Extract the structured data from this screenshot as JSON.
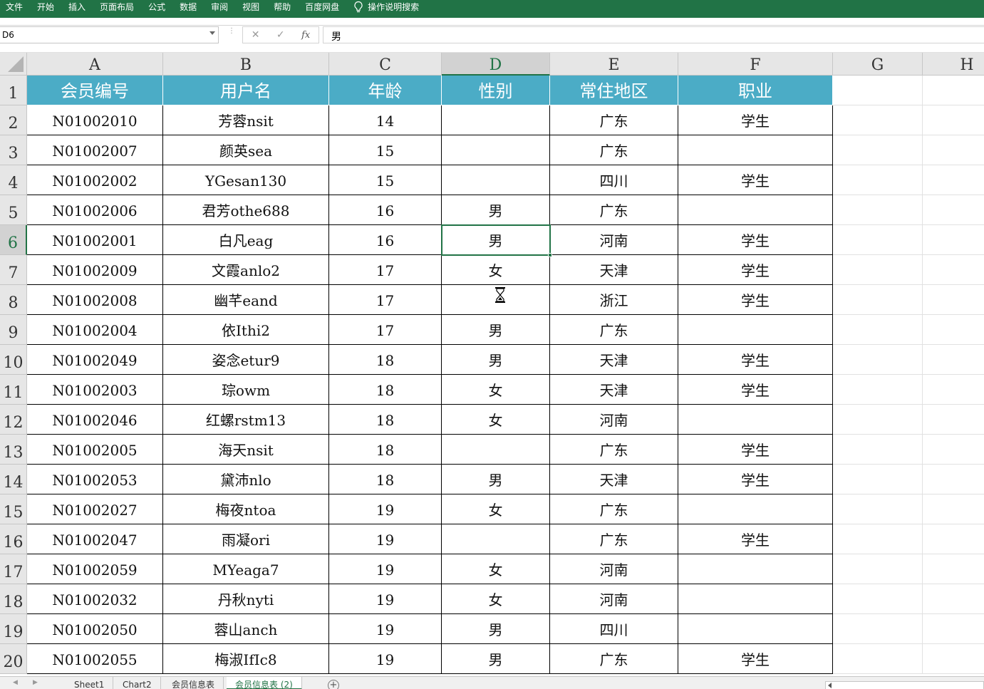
{
  "ribbon": {
    "tabs": [
      "文件",
      "开始",
      "插入",
      "页面布局",
      "公式",
      "数据",
      "审阅",
      "视图",
      "帮助",
      "百度网盘"
    ],
    "search_label": "操作说明搜索"
  },
  "formula_bar": {
    "name_box": "D6",
    "formula": "男"
  },
  "columns": [
    "A",
    "B",
    "C",
    "D",
    "E",
    "F",
    "G",
    "H"
  ],
  "selected_column": "D",
  "selected_row": 6,
  "rows": [
    "1",
    "2",
    "3",
    "4",
    "5",
    "6",
    "7",
    "8",
    "9",
    "10",
    "11",
    "12",
    "13",
    "14",
    "15",
    "16",
    "17",
    "18",
    "19",
    "20"
  ],
  "table": {
    "headers": [
      "会员编号",
      "用户名",
      "年龄",
      "性别",
      "常住地区",
      "职业"
    ],
    "data": [
      [
        "N01002010",
        "芳蓉nsit",
        "14",
        "",
        "广东",
        "学生"
      ],
      [
        "N01002007",
        "颜英sea",
        "15",
        "",
        "广东",
        ""
      ],
      [
        "N01002002",
        "YGesan130",
        "15",
        "",
        "四川",
        "学生"
      ],
      [
        "N01002006",
        "君芳othe688",
        "16",
        "男",
        "广东",
        ""
      ],
      [
        "N01002001",
        "白凡eag",
        "16",
        "男",
        "河南",
        "学生"
      ],
      [
        "N01002009",
        "文霞anlo2",
        "17",
        "女",
        "天津",
        "学生"
      ],
      [
        "N01002008",
        "幽芊eand",
        "17",
        "",
        "浙江",
        "学生"
      ],
      [
        "N01002004",
        "依Ithi2",
        "17",
        "男",
        "广东",
        ""
      ],
      [
        "N01002049",
        "姿念etur9",
        "18",
        "男",
        "天津",
        "学生"
      ],
      [
        "N01002003",
        "琮owm",
        "18",
        "女",
        "天津",
        "学生"
      ],
      [
        "N01002046",
        "红螺rstm13",
        "18",
        "女",
        "河南",
        ""
      ],
      [
        "N01002005",
        "海天nsit",
        "18",
        "",
        "广东",
        "学生"
      ],
      [
        "N01002053",
        "黛沛nlo",
        "18",
        "男",
        "天津",
        "学生"
      ],
      [
        "N01002027",
        "梅夜ntoa",
        "19",
        "女",
        "广东",
        ""
      ],
      [
        "N01002047",
        "雨凝ori",
        "19",
        "",
        "广东",
        "学生"
      ],
      [
        "N01002059",
        "MYeaga7",
        "19",
        "女",
        "河南",
        ""
      ],
      [
        "N01002032",
        "丹秋nyti",
        "19",
        "女",
        "河南",
        ""
      ],
      [
        "N01002050",
        "蓉山anch",
        "19",
        "男",
        "四川",
        ""
      ],
      [
        "N01002055",
        "梅淑IfIc8",
        "19",
        "男",
        "广东",
        "学生"
      ]
    ]
  },
  "sheet_tabs": [
    "Sheet1",
    "Chart2",
    "会员信息表",
    "会员信息表 (2)"
  ],
  "active_sheet": "会员信息表 (2)",
  "colors": {
    "ribbon": "#217346",
    "header_fill": "#4bacc6",
    "selection": "#217346"
  },
  "icons": [
    "lightbulb-icon",
    "cancel-icon",
    "enter-icon",
    "function-icon",
    "hourglass-icon",
    "add-sheet-icon"
  ]
}
